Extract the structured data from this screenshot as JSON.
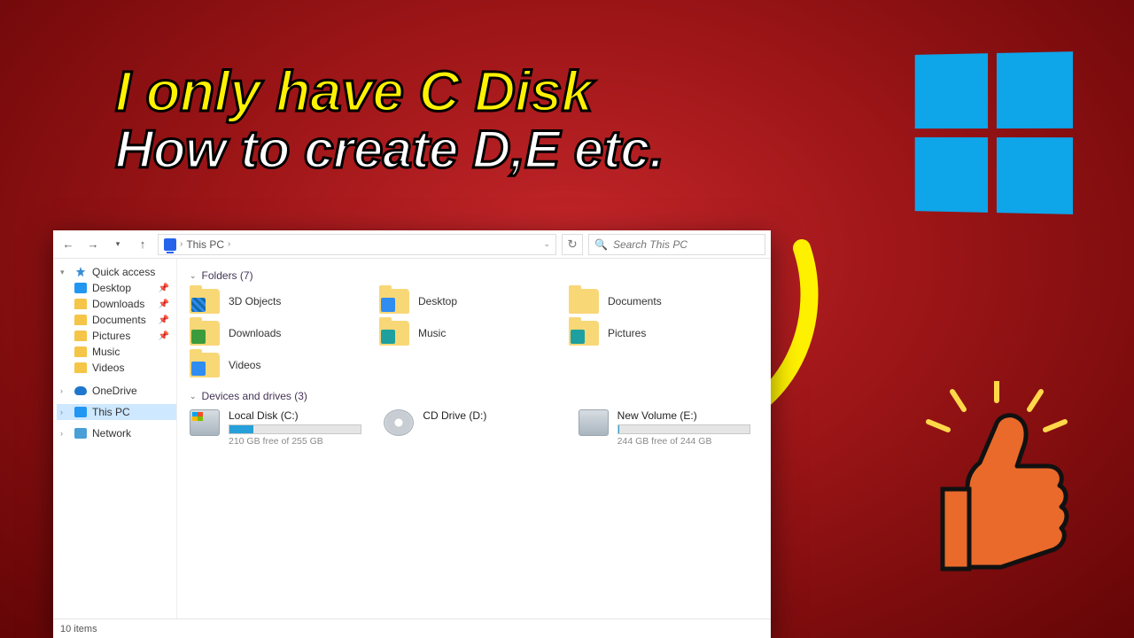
{
  "headline": {
    "line1": "I only have C Disk",
    "line2": "How to create D,E etc."
  },
  "addressbar": {
    "crumb": "This PC",
    "crumb_sep": "›",
    "search_placeholder": "Search This PC"
  },
  "sidebar": {
    "quick_access": "Quick access",
    "items": [
      {
        "label": "Desktop",
        "pinned": true
      },
      {
        "label": "Downloads",
        "pinned": true
      },
      {
        "label": "Documents",
        "pinned": true
      },
      {
        "label": "Pictures",
        "pinned": true
      },
      {
        "label": "Music",
        "pinned": false
      },
      {
        "label": "Videos",
        "pinned": false
      }
    ],
    "onedrive": "OneDrive",
    "this_pc": "This PC",
    "network": "Network"
  },
  "sections": {
    "folders_header": "Folders (7)",
    "drives_header": "Devices and drives (3)"
  },
  "folders": [
    {
      "label": "3D Objects",
      "badge": "cube"
    },
    {
      "label": "Desktop",
      "badge": "blue"
    },
    {
      "label": "Documents",
      "badge": ""
    },
    {
      "label": "Downloads",
      "badge": "green"
    },
    {
      "label": "Music",
      "badge": "teal"
    },
    {
      "label": "Pictures",
      "badge": "teal"
    },
    {
      "label": "Videos",
      "badge": "blue"
    }
  ],
  "drives": [
    {
      "name": "Local Disk (C:)",
      "type": "hdd",
      "free": "210 GB free of 255 GB",
      "fill_pct": 18
    },
    {
      "name": "CD Drive (D:)",
      "type": "cd",
      "free": "",
      "fill_pct": null
    },
    {
      "name": "New Volume (E:)",
      "type": "hdd",
      "free": "244 GB free of 244 GB",
      "fill_pct": 1
    }
  ],
  "statusbar": {
    "items": "10 items"
  }
}
